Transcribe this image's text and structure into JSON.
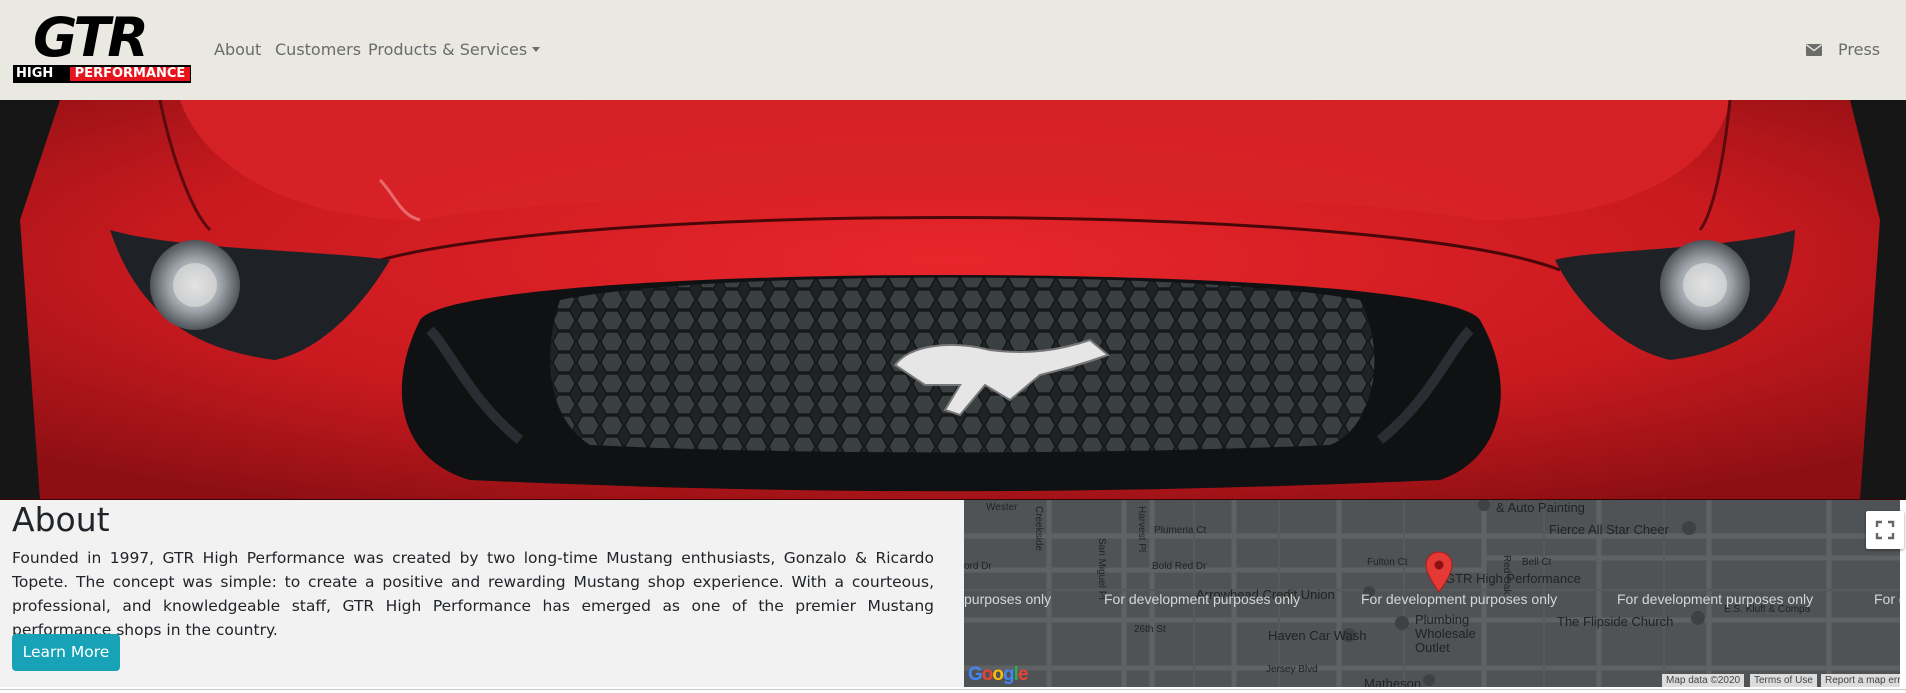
{
  "brand": {
    "logo_top": "GTR",
    "logo_left": "HIGH",
    "logo_right": "PERFORMANCE"
  },
  "nav": {
    "about": "About",
    "customers": "Customers",
    "products": "Products & Services",
    "press": "Press"
  },
  "about": {
    "heading": "About",
    "body": "Founded in 1997, GTR High Performance was created by two long-time Mustang enthusiasts, Gonzalo & Ricardo Topete. The concept was simple: to create a positive and rewarding Mustang shop experience. With a courteous, professional, and knowledgeable staff, GTR High Performance has emerged as one of the premier Mustang performance shops in the country.",
    "button": "Learn More"
  },
  "map": {
    "streets": [
      "Wester",
      "Creekside",
      "Harvest Pl",
      "San Miguel Pl",
      "Plumeria Ct",
      "Bold Red Dr",
      "ord Dr",
      "Fulton Ct",
      "Bell Ct",
      "Red Oak",
      "26th St",
      "Jersey Blvd"
    ],
    "places": [
      "& Auto Painting",
      "Fierce All Star Cheer",
      "Arrowhead Credit Union",
      "GTR High Performance",
      "Haven Car Wash",
      "Plumbing Wholesale Outlet",
      "The Flipside Church",
      "E.S. Kluft & Compa",
      "Matheson"
    ],
    "dev_text": "For development purposes only",
    "dev_labels": [
      "purposes only",
      "For development purposes only",
      "For development purposes only",
      "For development purposes only",
      "For d"
    ],
    "google": "Google",
    "footer": [
      "Map data ©2020",
      "Terms of Use",
      "Report a map err"
    ]
  },
  "colors": {
    "accent": "#17a2b8",
    "navbar": "#e9e8e1",
    "brand_red": "#e8141c",
    "pin": "#e53935"
  },
  "icons": [
    "envelope-icon",
    "fullscreen-icon",
    "map-pin-icon",
    "dropdown-caret-icon"
  ]
}
